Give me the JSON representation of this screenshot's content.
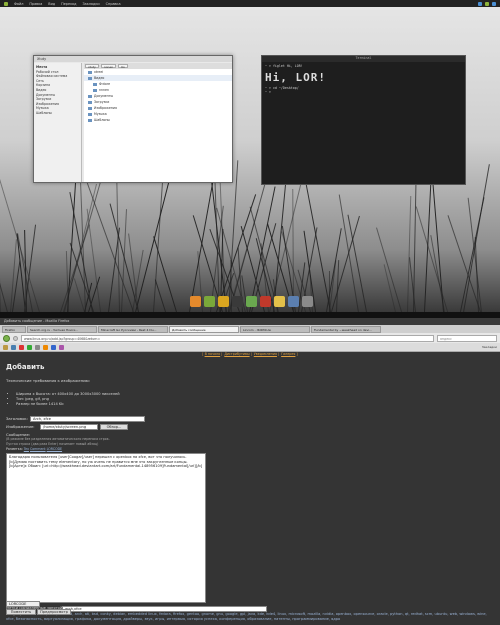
{
  "desktop": {
    "topbar": {
      "menu": [
        "Файл",
        "Правка",
        "Вид",
        "Переход",
        "Закладки",
        "Справка"
      ]
    },
    "file_manager": {
      "title": "Xtuty",
      "side_header": "Места",
      "side_items": [
        "Рабочий стол",
        "Файловая система",
        "Сеть",
        "Корзина",
        "Видео",
        "Документы",
        "Загрузки",
        "Изображения",
        "Музыка",
        "Шаблоны"
      ],
      "crumbs": [
        "xtuty",
        "nonen",
        "Ko"
      ],
      "rows": [
        "xtreei",
        "Видео",
        "Фчtore",
        "nnnen",
        "Документы",
        "Загрузки",
        "Изображения",
        "Музыка",
        "Шаблоны"
      ]
    },
    "terminal": {
      "title": "Terminal",
      "line1": "~ > figlet Hi, LOR!",
      "big": "Hi, LOR!",
      "line2": "~ > cd ~/Desktop/",
      "line3": "~ >"
    }
  },
  "browser": {
    "window_title": "Добавить сообщение - Mozilla Firefox",
    "tabs": [
      {
        "label": "Firefox",
        "active": false
      },
      {
        "label": "Search.org.ru - Уютная Поиск...",
        "active": false
      },
      {
        "label": "Minecraft Go Русскими - Rest 4 Du...",
        "active": false
      },
      {
        "label": "Добавить сообщение",
        "active": true
      },
      {
        "label": "Lincoln - ЖЖМолк",
        "active": false
      },
      {
        "label": "Fundamental by ~weakhead on devi...",
        "active": false
      }
    ],
    "url": "www.linux.org.ru/add.jsp?group=4068&return=",
    "search_placeholder": "яндекс",
    "bookmarks_label": "Закладки",
    "site_nav": [
      "В начало",
      "Дистрибутивы",
      "Уведомления",
      "Галерея"
    ],
    "page": {
      "heading": "Добавить",
      "requirements_title": "Технические требования к изображению:",
      "requirements": [
        "Ширина x Высота: от 400x400 до 3000x3000 пикселей",
        "Тип: jpeg, gif, png",
        "Размер не более 1414 Kb"
      ],
      "title_label": "Заголовок:",
      "title_value": "Arch, xfce",
      "image_label": "Изображение:",
      "image_value": "/home/xtuty/screen.png",
      "browse_label": "Обзор...",
      "message_label": "Сообщение:",
      "hint1": "(В режиме без разделения автоматического переноса строк.",
      "hint2": "Пустая строка (два раза Enter) начинает новый абзац)",
      "markup_label": "Разметка:",
      "markup_options": [
        "Tex",
        "Comment",
        "LORCODE"
      ],
      "message_text": "Благодарю пользователя [user]Coogar[/user] перешел с openbox на xfce, вот что получилось. [b]Думаю поставить тему elementary, но уж очень не нравится мне это закругленные концы.[b]Арте]х Обоин: [url=http://weakhead.deviantart.com/art/Fundamental-148956109]Fundamental[/url][/b]",
      "tags_label": "Метки (разделенные запятой)",
      "tags_value": "arch,xfce",
      "popular_label": "Популярные теги:",
      "popular_tags": "3d, amd, android, arch, ati, bsd, conky, debian, embedded linux, fedora, firefox, gentoo, gnome, gnu, google, gpl, java, kde, kde4, linux, microsoft, mozilla, nvidia, openbox, opensource, oracle, python, qt, redhat, scm, ubuntu, web, windows, wine, xfce, безопасность, виртуализация, графика, документация, драйверы, звук, игры, интервью, история успеха, конференция, образование, патенты, программирование, ядро",
      "markup_select": "LORCODE",
      "submit_label": "Поместить",
      "preview_label": "Предпросмотр"
    }
  }
}
